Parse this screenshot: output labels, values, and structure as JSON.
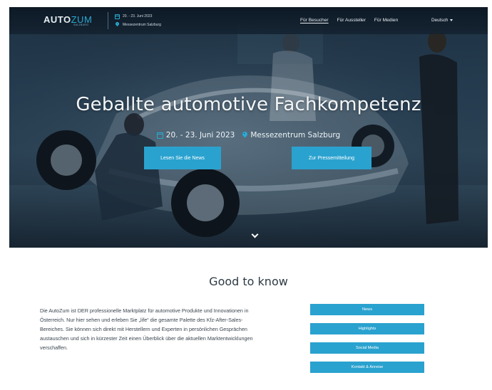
{
  "header": {
    "logo": {
      "part1": "AUTO",
      "part2": "ZUM",
      "sub": "SALZBURG"
    },
    "event": {
      "date": "20. - 23. Juni 2023",
      "location": "Messezentrum Salzburg"
    },
    "nav": [
      {
        "label": "Für Besucher",
        "active": true
      },
      {
        "label": "Für Aussteller",
        "active": false
      },
      {
        "label": "Für Medien",
        "active": false
      }
    ],
    "language": "Deutsch"
  },
  "hero": {
    "title": "Geballte automotive Fachkompetenz",
    "date": "20. - 23. Juni 2023",
    "location": "Messezentrum Salzburg",
    "btn_news": "Lesen Sie die News",
    "btn_press": "Zur Pressemitteilung"
  },
  "info": {
    "title": "Good to know",
    "text": "Die AutoZum ist DER professionelle Marktplatz für automotive Produkte und Innovationen in Österreich. Nur hier sehen und erleben Sie „life“ die gesamte Palette des Kfz-After-Sales-Bereiches. Sie können sich direkt mit Herstellern und Experten in persönlichen Gesprächen austauschen und sich in kürzester Zeit einen Überblick über die aktuellen Marktentwicklungen verschaffen.",
    "buttons": [
      "News",
      "Highlights",
      "Social Media",
      "Kontakt & Anreise"
    ]
  },
  "colors": {
    "accent": "#2aa2cf",
    "nav_bg": "#0f1e2c",
    "text": "#3b4650"
  },
  "icons": [
    "calendar-icon",
    "location-pin-icon",
    "chevron-down-icon",
    "caret-down-icon"
  ]
}
